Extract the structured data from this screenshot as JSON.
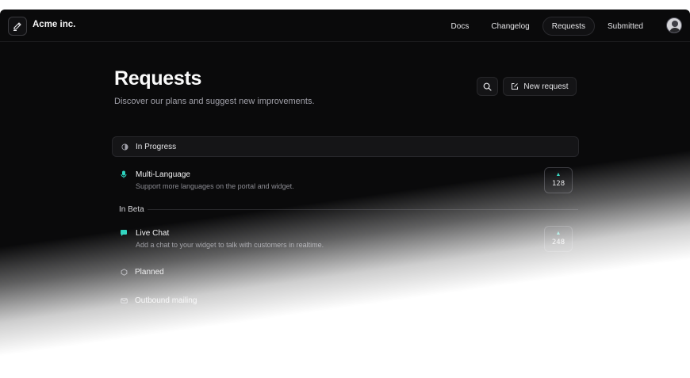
{
  "brand": {
    "name": "Acme inc.",
    "logo_icon": "pencil-icon"
  },
  "nav": {
    "items": [
      {
        "label": "Docs",
        "active": false
      },
      {
        "label": "Changelog",
        "active": false
      },
      {
        "label": "Requests",
        "active": true
      },
      {
        "label": "Submitted",
        "active": false
      }
    ],
    "avatar_icon": "user-avatar"
  },
  "header": {
    "title": "Requests",
    "subtitle": "Discover our plans and suggest new improvements.",
    "search_icon": "search-icon",
    "new_request_label": "New request",
    "new_request_icon": "edit-icon"
  },
  "sections": {
    "in_progress": {
      "label": "In Progress",
      "icon": "half-circle-icon",
      "items": [
        {
          "title": "Multi-Language",
          "description": "Support more languages on the portal and widget.",
          "votes": "128",
          "icon": "microphone-icon",
          "icon_color": "#2dd4bf"
        }
      ]
    },
    "in_beta": {
      "label": "In Beta",
      "items": [
        {
          "title": "Live Chat",
          "description": "Add a chat to your widget to talk with customers in realtime.",
          "votes": "248",
          "icon": "chat-bubble-icon",
          "icon_color": "#2dd4bf"
        }
      ]
    },
    "planned": {
      "label": "Planned",
      "icon": "hexagon-icon"
    },
    "outbound": {
      "label": "Outbound mailing",
      "icon": "mail-icon"
    }
  },
  "colors": {
    "background": "#0a0a0b",
    "accent": "#2dd4bf",
    "text": "#f4f4f5",
    "muted": "#a1a1aa"
  }
}
